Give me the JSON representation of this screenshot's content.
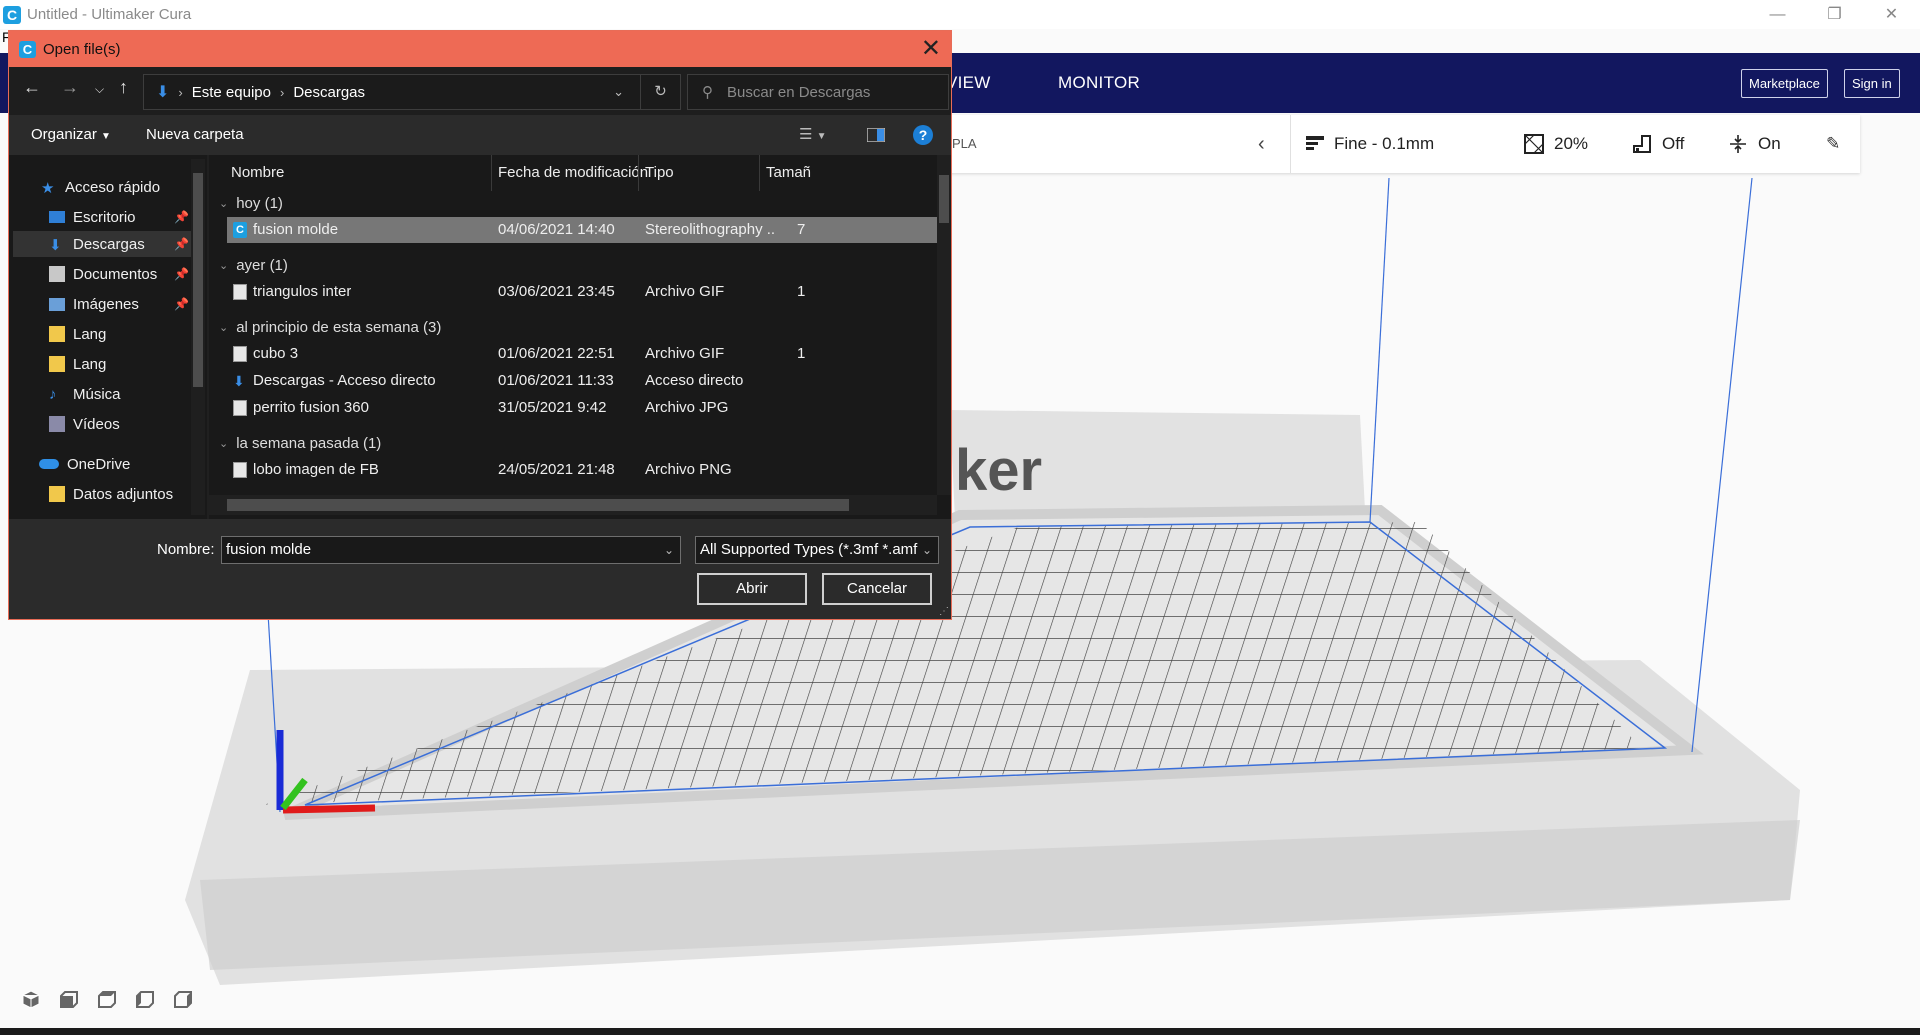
{
  "app": {
    "title": "Untitled - Ultimaker Cura",
    "menu_edge": "F",
    "window_controls": [
      "minimize-icon",
      "restore-icon",
      "close-icon"
    ]
  },
  "cura_header": {
    "nav": [
      "VIEW",
      "MONITOR"
    ],
    "marketplace_label": "Marketplace",
    "signin_label": "Sign in"
  },
  "print_settings": {
    "material_edge": "PLA",
    "profile": "Fine - 0.1mm",
    "infill": "20%",
    "support": "Off",
    "adhesion": "On"
  },
  "viewport": {
    "bed_logo_text": "ker"
  },
  "dialog": {
    "title": "Open file(s)",
    "breadcrumb": [
      "Este equipo",
      "Descargas"
    ],
    "search_placeholder": "Buscar en Descargas",
    "toolbar": {
      "organize": "Organizar",
      "new_folder": "Nueva carpeta"
    },
    "nav_pane": [
      {
        "label": "Acceso rápido",
        "icon": "star-icon",
        "pinned": false
      },
      {
        "label": "Escritorio",
        "icon": "desktop-icon",
        "pinned": true
      },
      {
        "label": "Descargas",
        "icon": "download-icon",
        "pinned": true,
        "selected": true
      },
      {
        "label": "Documentos",
        "icon": "document-icon",
        "pinned": true
      },
      {
        "label": "Imágenes",
        "icon": "image-icon",
        "pinned": true
      },
      {
        "label": "Lang",
        "icon": "folder-icon",
        "pinned": false
      },
      {
        "label": "Lang",
        "icon": "folder-icon",
        "pinned": false
      },
      {
        "label": "Música",
        "icon": "music-icon",
        "pinned": false
      },
      {
        "label": "Vídeos",
        "icon": "video-icon",
        "pinned": false
      },
      {
        "label": "OneDrive",
        "icon": "cloud-icon",
        "pinned": false
      },
      {
        "label": "Datos adjuntos",
        "icon": "folder-icon",
        "pinned": false
      }
    ],
    "columns": [
      "Nombre",
      "Fecha de modificación",
      "Tipo",
      "Tamañ"
    ],
    "groups": [
      {
        "label": "hoy (1)"
      },
      {
        "label": "ayer (1)"
      },
      {
        "label": "al principio de esta semana (3)"
      },
      {
        "label": "la semana pasada (1)"
      }
    ],
    "files": [
      {
        "name": "fusion molde",
        "date": "04/06/2021 14:40",
        "type": "Stereolithography ...",
        "size": "7",
        "icon": "cura-file-icon",
        "selected": true
      },
      {
        "name": "triangulos inter",
        "date": "03/06/2021 23:45",
        "type": "Archivo GIF",
        "size": "1",
        "icon": "file-icon"
      },
      {
        "name": "cubo 3",
        "date": "01/06/2021 22:51",
        "type": "Archivo GIF",
        "size": "1",
        "icon": "file-icon"
      },
      {
        "name": "Descargas - Acceso directo",
        "date": "01/06/2021 11:33",
        "type": "Acceso directo",
        "size": "",
        "icon": "shortcut-icon"
      },
      {
        "name": "perrito fusion 360",
        "date": "31/05/2021 9:42",
        "type": "Archivo JPG",
        "size": "",
        "icon": "file-icon"
      },
      {
        "name": "lobo imagen de FB",
        "date": "24/05/2021 21:48",
        "type": "Archivo PNG",
        "size": "",
        "icon": "file-icon"
      }
    ],
    "filename_label": "Nombre:",
    "filename_value": "fusion molde",
    "filetype_value": "All Supported Types (*.3mf *.amf",
    "open_label": "Abrir",
    "cancel_label": "Cancelar"
  }
}
